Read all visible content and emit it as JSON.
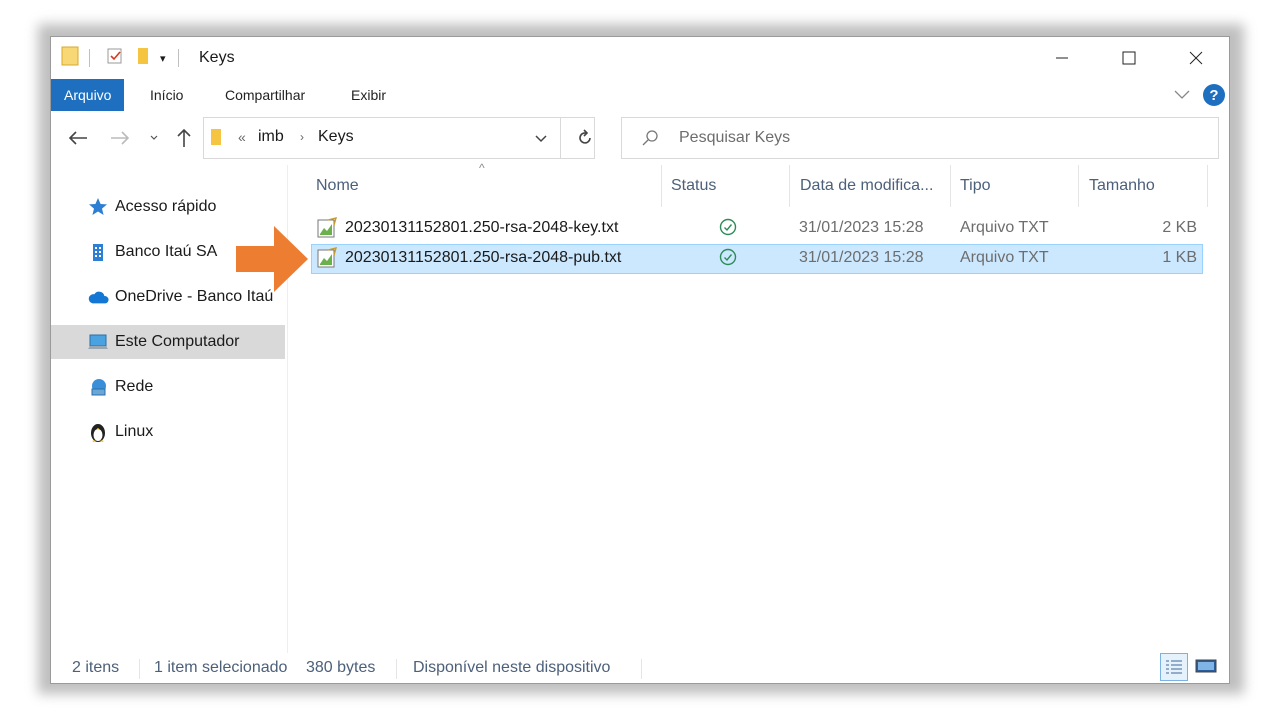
{
  "window": {
    "title": "Keys"
  },
  "ribbon": {
    "tabs": [
      "Arquivo",
      "Início",
      "Compartilhar",
      "Exibir"
    ]
  },
  "address": {
    "crumbs": [
      "«",
      "imb",
      "Keys"
    ]
  },
  "search": {
    "placeholder": "Pesquisar Keys"
  },
  "sidebar": {
    "items": [
      {
        "label": "Acesso rápido",
        "icon": "star-icon"
      },
      {
        "label": "Banco Itaú SA",
        "icon": "building-icon"
      },
      {
        "label": "OneDrive - Banco Itaú",
        "icon": "cloud-icon"
      },
      {
        "label": "Este Computador",
        "icon": "computer-icon"
      },
      {
        "label": "Rede",
        "icon": "network-icon"
      },
      {
        "label": "Linux",
        "icon": "penguin-icon"
      }
    ]
  },
  "columns": [
    "Nome",
    "Status",
    "Data de modifica...",
    "Tipo",
    "Tamanho"
  ],
  "files": [
    {
      "name": "20230131152801.250-rsa-2048-key.txt",
      "date": "31/01/2023 15:28",
      "type": "Arquivo TXT",
      "size": "2 KB",
      "selected": false
    },
    {
      "name": "20230131152801.250-rsa-2048-pub.txt",
      "date": "31/01/2023 15:28",
      "type": "Arquivo TXT",
      "size": "1 KB",
      "selected": true
    }
  ],
  "statusbar": {
    "count": "2 itens",
    "selection": "1 item selecionado",
    "size": "380 bytes",
    "availability": "Disponível neste dispositivo"
  },
  "colors": {
    "accent": "#1e6fbf",
    "selection_bg": "#cce8ff",
    "arrow": "#ed7d31",
    "status_ok": "#2e8b57"
  }
}
